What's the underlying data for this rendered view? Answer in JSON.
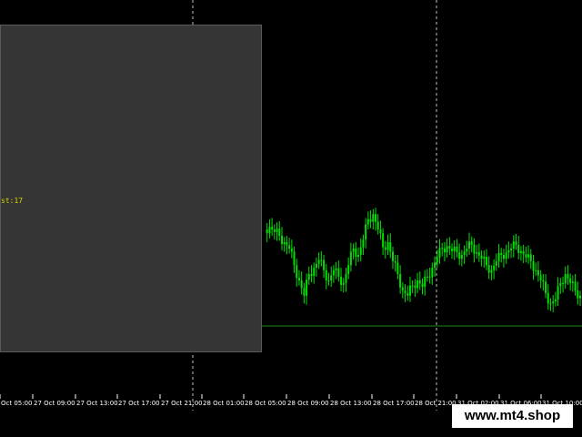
{
  "colors": {
    "background": "#000000",
    "candle": "#00e000",
    "level_line": "#1a8a1a",
    "panel": "#353535",
    "grid_dashed": "#bfbfbf",
    "axis_text": "#ffffff",
    "panel_text": "#d4d400"
  },
  "panel": {
    "text": "st:17"
  },
  "watermark": {
    "text": "www.mt4.shop"
  },
  "chart_data": {
    "type": "candlestick",
    "x_tick_labels": [
      "Oct 05:00",
      "27 Oct 09:00",
      "27 Oct 13:00",
      "27 Oct 17:00",
      "27 Oct 21:00",
      "28 Oct 01:00",
      "28 Oct 05:00",
      "28 Oct 09:00",
      "28 Oct 13:00",
      "28 Oct 17:00",
      "28 Oct 21:00",
      "31 Oct 02:00",
      "31 Oct 06:00",
      "31 Oct 10:00"
    ],
    "price_series_relative": [
      0.7,
      0.72,
      0.68,
      0.65,
      0.6,
      0.55,
      0.42,
      0.3,
      0.18,
      0.35,
      0.4,
      0.46,
      0.38,
      0.3,
      0.38,
      0.33,
      0.28,
      0.42,
      0.55,
      0.5,
      0.62,
      0.78,
      0.82,
      0.7,
      0.56,
      0.6,
      0.45,
      0.35,
      0.22,
      0.18,
      0.26,
      0.3,
      0.25,
      0.33,
      0.4,
      0.48,
      0.55,
      0.57,
      0.53,
      0.52,
      0.5,
      0.55,
      0.58,
      0.52,
      0.47,
      0.42,
      0.38,
      0.45,
      0.5,
      0.52,
      0.55,
      0.58,
      0.53,
      0.48,
      0.45,
      0.38,
      0.3,
      0.2,
      0.12,
      0.15,
      0.28,
      0.35,
      0.28,
      0.22,
      0.18
    ],
    "level_line_relative": 0.0
  }
}
